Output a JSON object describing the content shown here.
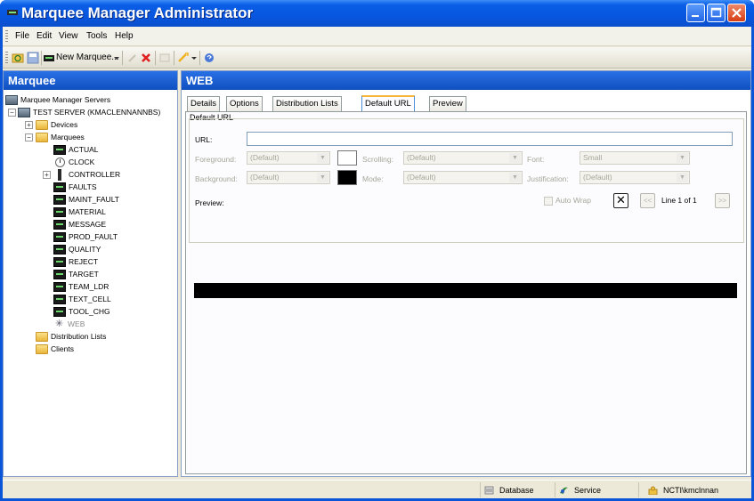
{
  "window": {
    "title": "Marquee Manager Administrator"
  },
  "menu": {
    "items": [
      "File",
      "Edit",
      "View",
      "Tools",
      "Help"
    ]
  },
  "toolbar": {
    "new_marquee_label": "New Marquee..."
  },
  "left_panel": {
    "header": "Marquee",
    "tree": {
      "root": "Marquee Manager Servers",
      "server": "TEST SERVER (KMACLENNANNBS)",
      "devices": "Devices",
      "marquees": "Marquees",
      "marquee_items": [
        "ACTUAL",
        "CLOCK",
        "CONTROLLER",
        "FAULTS",
        "MAINT_FAULT",
        "MATERIAL",
        "MESSAGE",
        "PROD_FAULT",
        "QUALITY",
        "REJECT",
        "TARGET",
        "TEAM_LDR",
        "TEXT_CELL",
        "TOOL_CHG",
        "WEB"
      ],
      "distribution_lists": "Distribution Lists",
      "clients": "Clients"
    }
  },
  "right_panel": {
    "header": "WEB",
    "tabs": [
      "Details",
      "Options",
      "Distribution Lists",
      "Default URL",
      "Preview"
    ],
    "active_tab": "Default URL",
    "group_title": "Default URL",
    "url_label": "URL:",
    "url_value": "",
    "foreground_label": "Foreground:",
    "foreground_value": "(Default)",
    "foreground_color": "#ffffff",
    "background_label": "Background:",
    "background_value": "(Default)",
    "background_color": "#000000",
    "scrolling_label": "Scrolling:",
    "scrolling_value": "(Default)",
    "mode_label": "Mode:",
    "mode_value": "(Default)",
    "font_label": "Font:",
    "font_value": "Small",
    "justification_label": "Justification:",
    "justification_value": "(Default)",
    "preview_label": "Preview:",
    "auto_wrap_label": "Auto Wrap",
    "line_indicator": "Line 1 of 1"
  },
  "statusbar": {
    "database": "Database",
    "service": "Service",
    "user": "NCTI\\kmclnnan"
  }
}
